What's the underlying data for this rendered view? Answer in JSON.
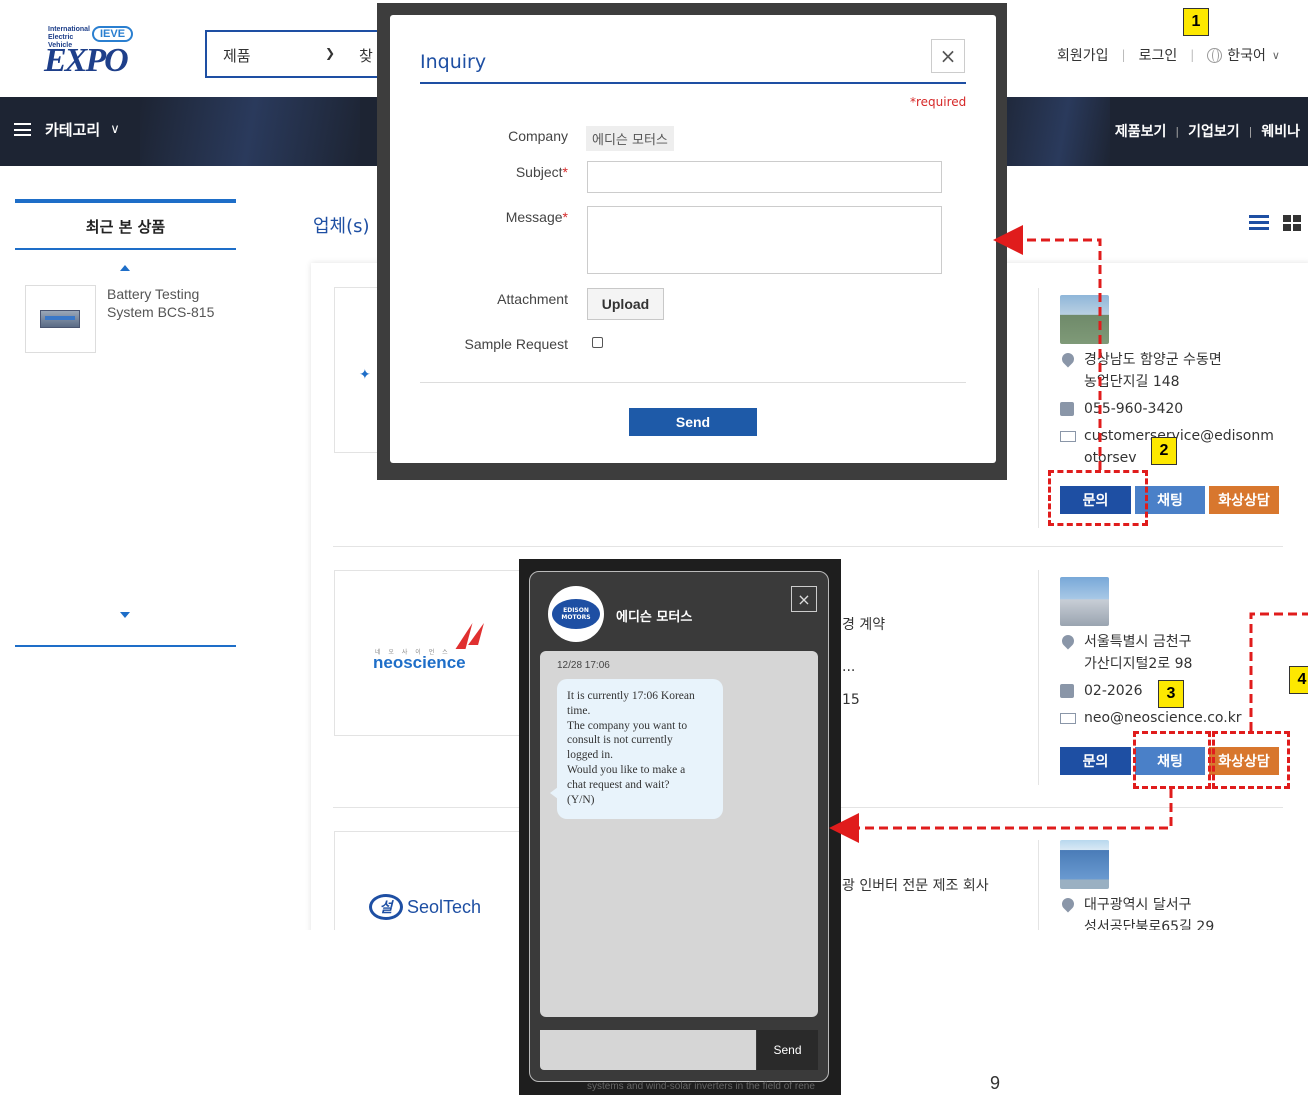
{
  "header": {
    "logo_small": "International Electric Vehicle",
    "logo_badge": "IEVE",
    "logo_word": "EXPO",
    "search_category": "제품",
    "search_text_fragment": "찾",
    "links": [
      "회원가입",
      "로그인",
      "한국어"
    ]
  },
  "nav": {
    "category_label": "카테고리",
    "right_links": [
      "제품보기",
      "기업보기",
      "웨비나"
    ]
  },
  "recent": {
    "title": "최근 본 상품",
    "item_name": "Battery Testing System BCS-815"
  },
  "list": {
    "title_fragment": "업체(s)"
  },
  "companies": [
    {
      "address_line1": "경상남도 함양군 수동면",
      "address_line2": "농업단지길 148",
      "phone": "055-960-3420",
      "email_line1": "customerservice@edisonm",
      "email_line2": "otorsev",
      "buttons": [
        "문의",
        "채팅",
        "화상상담"
      ]
    },
    {
      "logo_word": "neoscience",
      "logo_small": "네 오 사 이 언 스",
      "desc_fragment1": "경 계약",
      "desc_fragment2": "...",
      "desc_fragment3": "15",
      "address_line1": "서울특별시 금천구",
      "address_line2": "가산디지털2로 98",
      "phone": "02-2026",
      "email": "neo@neoscience.co.kr",
      "buttons": [
        "문의",
        "채팅",
        "화상상담"
      ]
    },
    {
      "logo_mark": "설",
      "logo_word": "SeolTech",
      "desc_fragment": "광 인버터 전문 제조 회사",
      "address_line1": "대구광역시 달서구",
      "address_line2": "성서공단북로65길 29"
    }
  ],
  "inquiry_modal": {
    "title": "Inquiry",
    "close": "×",
    "required_note": "*required",
    "company_label": "Company",
    "company_value": "에디슨 모터스",
    "subject_label": "Subject",
    "message_label": "Message",
    "attachment_label": "Attachment",
    "upload_label": "Upload",
    "sample_label": "Sample Request",
    "send_label": "Send",
    "star": "*"
  },
  "chat_window": {
    "avatar_text": "EDISON MOTORS",
    "company_name": "에디슨 모터스",
    "close": "×",
    "timestamp": "12/28 17:06",
    "message_lines": [
      "It is currently 17:06 Korean",
      "time.",
      "The company you want to",
      "consult is not currently",
      "logged in.",
      "Would you like to make a",
      "chat request and wait?",
      "(Y/N)"
    ],
    "send_label": "Send",
    "bleed_text": "systems and wind-solar inverters in the field of rene"
  },
  "annotations": {
    "badges": [
      "1",
      "2",
      "3",
      "4"
    ],
    "page_number": "9"
  },
  "colors": {
    "primary": "#1e4fa3",
    "chat_button": "#4a80c8",
    "video_button": "#d8772e",
    "annotation_red": "#e01c1c",
    "badge_yellow": "#fde800"
  }
}
